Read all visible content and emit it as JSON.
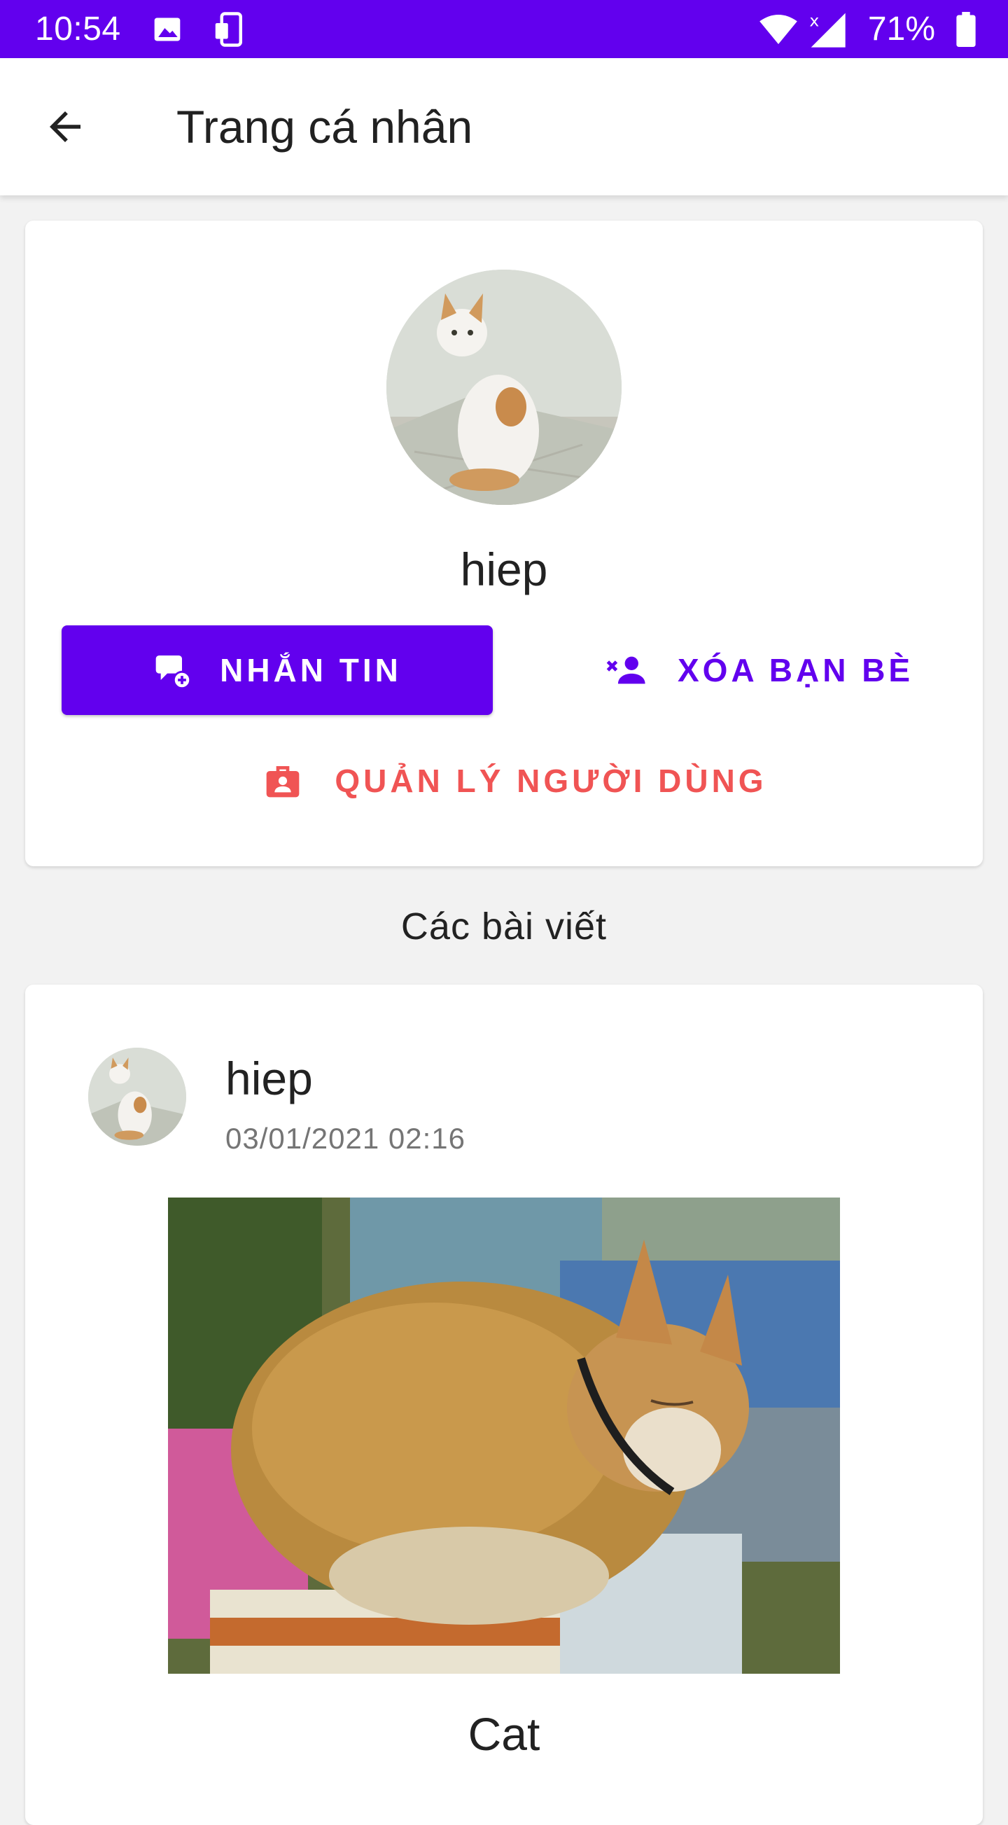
{
  "status_bar": {
    "time": "10:54",
    "battery": "71%",
    "icons": [
      "image-icon",
      "device-icon",
      "wifi-icon",
      "signal-icon",
      "battery-icon"
    ],
    "background": "#6200ee"
  },
  "app_bar": {
    "title": "Trang cá nhân",
    "back_icon": "arrow-back-icon"
  },
  "profile": {
    "name": "hiep",
    "avatar_icon": "cat-avatar-photo",
    "actions": {
      "message": {
        "label": "NHẮN TIN",
        "icon": "chat-add-icon",
        "color": "#6200ee"
      },
      "unfriend": {
        "label": "XÓA BẠN BÈ",
        "icon": "person-remove-icon",
        "color": "#6200ee"
      },
      "manage": {
        "label": "QUẢN LÝ NGƯỜI DÙNG",
        "icon": "badge-icon",
        "color": "#f05454"
      }
    }
  },
  "posts_section": {
    "heading": "Các bài viết",
    "posts": [
      {
        "author": "hiep",
        "timestamp": "03/01/2021 02:16",
        "image": "cat-photo",
        "caption": "Cat"
      }
    ]
  }
}
